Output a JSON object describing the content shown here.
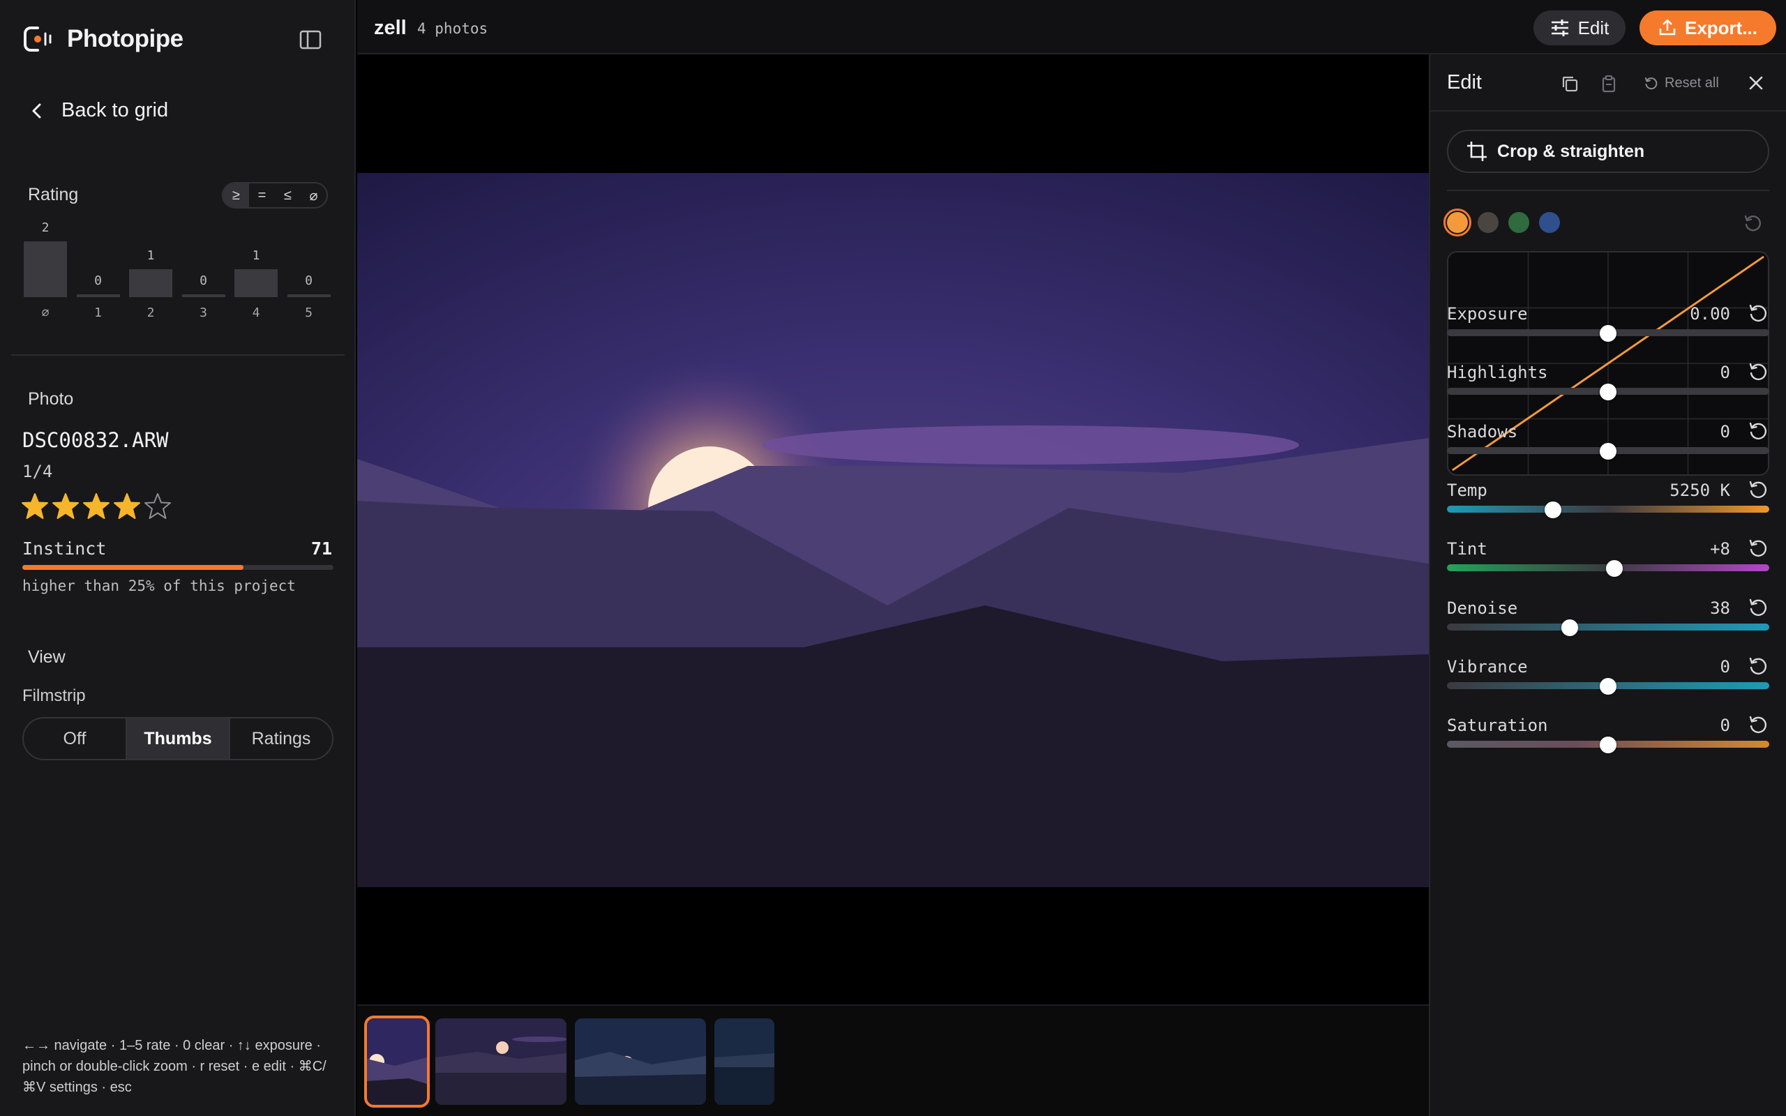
{
  "app": {
    "name": "Photopipe"
  },
  "sidebar": {
    "back_label": "Back to grid",
    "rating": {
      "title": "Rating",
      "filters": [
        "≥",
        "=",
        "≤",
        "⌀"
      ],
      "active_filter": 0,
      "histogram": [
        {
          "label": "⌀",
          "count": "2",
          "value": 2
        },
        {
          "label": "1",
          "count": "0",
          "value": 0
        },
        {
          "label": "2",
          "count": "1",
          "value": 1
        },
        {
          "label": "3",
          "count": "0",
          "value": 0
        },
        {
          "label": "4",
          "count": "1",
          "value": 1
        },
        {
          "label": "5",
          "count": "0",
          "value": 0
        }
      ]
    },
    "photo": {
      "title": "Photo",
      "filename": "DSC00832.ARW",
      "index": "1/4",
      "stars": 4,
      "stars_max": 5,
      "instinct_label": "Instinct",
      "instinct_value": "71",
      "instinct_fraction": 0.71,
      "instinct_note": "higher than 25% of this project"
    },
    "view": {
      "title": "View",
      "filmstrip_label": "Filmstrip",
      "options": [
        "Off",
        "Thumbs",
        "Ratings"
      ],
      "active": 1
    },
    "shortcuts": "←→ navigate · 1–5 rate · 0 clear · ↑↓ exposure · pinch or double-click zoom · r reset · e edit · ⌘C/⌘V settings · esc"
  },
  "topbar": {
    "project": "zell",
    "photo_count": "4 photos",
    "edit_label": "Edit",
    "export_label": "Export..."
  },
  "panel": {
    "title": "Edit",
    "reset_all": "Reset all",
    "crop_label": "Crop & straighten",
    "channels": [
      "#f59a3b",
      "#4a4540",
      "#2f6b3f",
      "#2f4f8f"
    ],
    "active_channel": 0,
    "sliders": [
      {
        "label": "Exposure",
        "value": "0.00",
        "position": 0.5,
        "gradient": "linear-gradient(90deg,#3a3a3f,#3a3a3f)"
      },
      {
        "label": "Highlights",
        "value": "0",
        "position": 0.5,
        "gradient": "linear-gradient(90deg,#3a3a3f,#3a3a3f)"
      },
      {
        "label": "Shadows",
        "value": "0",
        "position": 0.5,
        "gradient": "linear-gradient(90deg,#3a3a3f,#3a3a3f)"
      },
      {
        "label": "Temp",
        "value": "5250 K",
        "position": 0.33,
        "gradient": "linear-gradient(90deg,#1f9ab8,#3a3a3f 50%,#f0962e)"
      },
      {
        "label": "Tint",
        "value": "+8",
        "position": 0.52,
        "gradient": "linear-gradient(90deg,#23a35a,#3a3a3f 50%,#b347c8)"
      },
      {
        "label": "Denoise",
        "value": "38",
        "position": 0.38,
        "gradient": "linear-gradient(90deg,#3a3a3f,#1f9ab8)"
      },
      {
        "label": "Vibrance",
        "value": "0",
        "position": 0.5,
        "gradient": "linear-gradient(90deg,#3a3a3f,#1f9ab8)"
      },
      {
        "label": "Saturation",
        "value": "0",
        "position": 0.5,
        "gradient": "linear-gradient(90deg,#5a5a60,#6a4d5a 40%,#d6882e)"
      }
    ]
  },
  "colors": {
    "accent": "#f57a2b"
  }
}
